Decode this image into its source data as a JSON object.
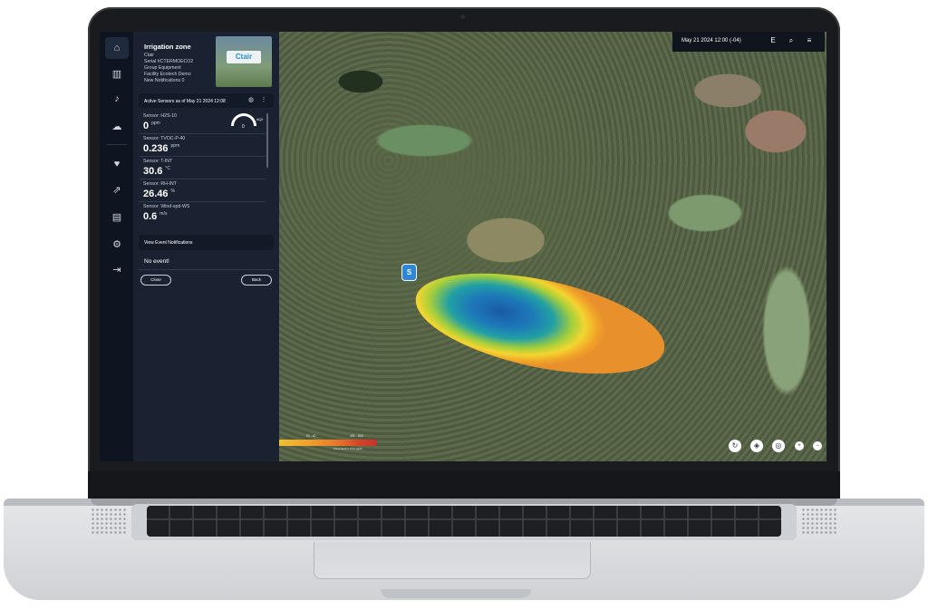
{
  "topbar": {
    "datetime": "May 21 2024 12:00 (-04)",
    "icons": [
      "E",
      "search-icon",
      "menu-icon"
    ]
  },
  "rail": {
    "icons": [
      "home-icon",
      "chart-icon",
      "bell-icon",
      "weather-icon",
      "heart-icon",
      "export-icon",
      "document-icon",
      "gear-icon",
      "logout-icon"
    ]
  },
  "zone": {
    "title": "Irrigation zone",
    "lines": [
      "Ctair",
      "Serial #CTERMOECO2",
      "Group Equipment",
      "Facility Ecotech Demo",
      "New Notifications 0"
    ],
    "thumbnail_text": "Ctair"
  },
  "active_sensors": {
    "header": "Active Sensors as of May 21 2024 12:08"
  },
  "sensors": [
    {
      "name": "Sensor: H2S-10",
      "value": "0",
      "unit": "ppm"
    },
    {
      "name": "Sensor: TVOC-P-40",
      "value": "0.236",
      "unit": "ppm"
    },
    {
      "name": "Sensor: T-INT",
      "value": "30.6",
      "unit": "°C"
    },
    {
      "name": "Sensor: RH-INT",
      "value": "26.46",
      "unit": "%"
    },
    {
      "name": "Sensor: Wind-spd-WS",
      "value": "0.6",
      "unit": "m/s"
    }
  ],
  "gauge": {
    "value": "0",
    "label": "AQI"
  },
  "events": {
    "header": "View Event Notifications",
    "empty": "No event!"
  },
  "buttons": {
    "close": "Close",
    "back": "Back"
  },
  "map": {
    "marker_label": "S",
    "legend": {
      "labels": [
        "",
        "51 - 67",
        "491 - 500"
      ],
      "caption": "Presented in TOU (ppb)"
    },
    "controls": [
      "compass-icon",
      "layers-icon",
      "locate-icon",
      "+",
      "−"
    ]
  }
}
